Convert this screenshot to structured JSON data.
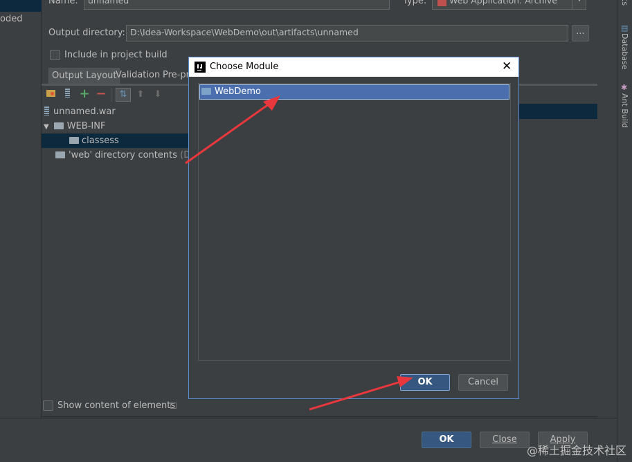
{
  "left_panel": {
    "partial_label": "oded"
  },
  "form": {
    "name_label": "Name:",
    "name_value": "unnamed",
    "type_label": "Type:",
    "type_value": "Web Application: Archive",
    "output_dir_label": "Output directory:",
    "output_dir_value": "D:\\Idea-Workspace\\WebDemo\\out\\artifacts\\unnamed",
    "browse_label": "...",
    "include_build_label": "Include in project build"
  },
  "tabs": [
    {
      "label": "Output Layout"
    },
    {
      "label": "Validation"
    },
    {
      "label": "Pre-pr"
    }
  ],
  "tree": {
    "items": [
      {
        "label": "unnamed.war"
      },
      {
        "label": "WEB-INF"
      },
      {
        "label": "classess"
      },
      {
        "label": "'web' directory contents",
        "suffix": "(D:\\Ic"
      }
    ]
  },
  "show_content_label": "Show content of elements",
  "dialog": {
    "title": "Choose Module",
    "modules": [
      {
        "label": "WebDemo"
      }
    ],
    "ok_label": "OK",
    "cancel_label": "Cancel"
  },
  "footer": {
    "ok_label": "OK",
    "close_label": "Close",
    "apply_label": "Apply"
  },
  "right_strip": {
    "partial_label": "ts",
    "database_label": "Database",
    "ant_label": "Ant Build"
  },
  "watermark": "@稀土掘金技术社区",
  "colors": {
    "background": "#3c3f41",
    "selection": "#4b6eaf",
    "primary_button": "#365880",
    "arrow": "#e8383d"
  }
}
